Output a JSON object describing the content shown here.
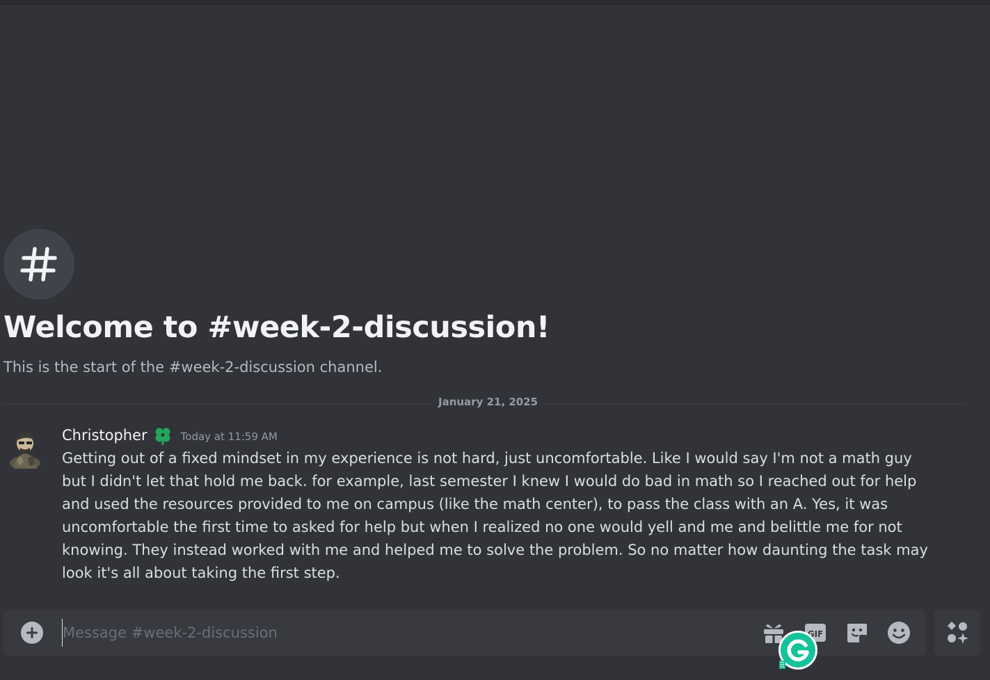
{
  "channel": {
    "welcome_title": "Welcome to #week-2-discussion!",
    "welcome_subtitle": "This is the start of the #week-2-discussion channel."
  },
  "divider": {
    "date": "January 21, 2025"
  },
  "message": {
    "username": "Christopher",
    "timestamp": "Today at 11:59 AM",
    "text": "Getting out of a fixed mindset in my experience is not hard, just uncomfortable. Like I would say I'm not a math guy but I didn't let that hold me back. for example, last semester I knew I would do bad in math so I reached out for help and used the resources provided to me on campus (like the math center), to pass the class with an A. Yes, it was uncomfortable the first time to asked for help but when I realized no one would yell and me and belittle me for not knowing. They instead worked with me and helped me to solve the problem. So no matter how daunting the task may look it's all about taking the first step."
  },
  "composer": {
    "placeholder": "Message #week-2-discussion",
    "gif_label": "GIF"
  },
  "icons": {
    "channel": "hash-icon",
    "badge": "clover-icon",
    "attach": "plus-circle-icon",
    "gift": "gift-icon",
    "gif": "gif-icon",
    "sticker": "sticker-icon",
    "emoji": "emoji-icon",
    "apps": "apps-icon",
    "extension": "grammarly-icon"
  },
  "colors": {
    "background": "#313338",
    "composer": "#383a40",
    "badge_green": "#23a55a",
    "grammarly_green": "#15c39a"
  }
}
